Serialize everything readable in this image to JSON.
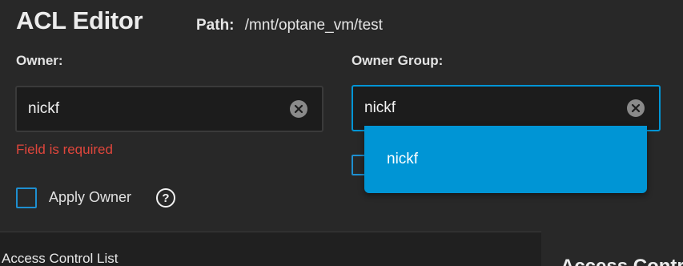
{
  "header": {
    "title": "ACL Editor",
    "path_label": "Path:",
    "path_value": "/mnt/optane_vm/test"
  },
  "owner": {
    "label": "Owner:",
    "value": "nickf",
    "error": "Field is required"
  },
  "owner_group": {
    "label": "Owner Group:",
    "value": "nickf",
    "dropdown_options": [
      "nickf"
    ]
  },
  "apply_owner": {
    "label": "Apply Owner",
    "checked": false,
    "help_icon": "?"
  },
  "bottom": {
    "acl_label": "Access Control List",
    "right_panel_title": "Access Control"
  },
  "colors": {
    "accent": "#0095d5",
    "error": "#e0463c",
    "background": "#282828"
  }
}
